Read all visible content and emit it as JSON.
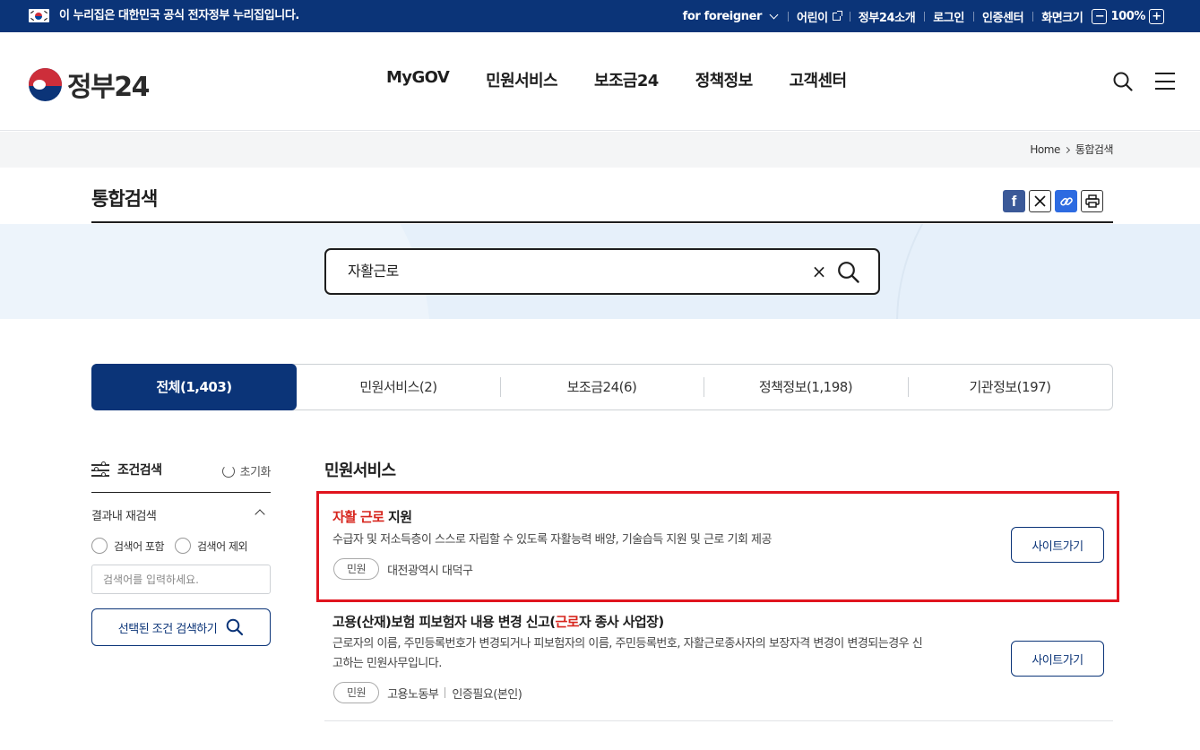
{
  "gov_banner": {
    "text": "이 누리집은 대한민국 공식 전자정부 누리집입니다.",
    "foreigner": "for foreigner",
    "kids": "어린이",
    "about": "정부24소개",
    "login": "로그인",
    "cert": "인증센터",
    "screen_size": "화면크기",
    "zoom_minus": "−",
    "zoom_value": "100%",
    "zoom_plus": "+"
  },
  "header": {
    "logo": "정부24",
    "menu": [
      "MyGOV",
      "민원서비스",
      "보조금24",
      "정책정보",
      "고객센터"
    ]
  },
  "breadcrumb": {
    "home": "Home",
    "current": "통합검색"
  },
  "page_title": "통합검색",
  "search": {
    "query": "자활근로",
    "clear": "×"
  },
  "tabs": [
    {
      "label": "전체(1,403)",
      "active": true
    },
    {
      "label": "민원서비스(2)"
    },
    {
      "label": "보조금24(6)"
    },
    {
      "label": "정책정보(1,198)"
    },
    {
      "label": "기관정보(197)"
    }
  ],
  "filter": {
    "title": "조건검색",
    "reset": "초기화",
    "section": "결과내 재검색",
    "include": "검색어 포함",
    "exclude": "검색어 제외",
    "placeholder": "검색어를 입력하세요.",
    "submit": "선택된 조건 검색하기"
  },
  "results": {
    "section_title": "민원서비스",
    "items": [
      {
        "title_hl": "자활 근로",
        "title_rest": " 지원",
        "desc": "수급자 및 저소득층이 스스로 자립할 수 있도록 자활능력 배양, 기술습득 지원 및 근로 기회 제공",
        "badge": "민원",
        "org": "대전광역시 대덕구",
        "button": "사이트가기"
      },
      {
        "title_pre": "고용(산재)보험 피보험자 내용 변경 신고(",
        "title_hl": "근로",
        "title_post": "자 종사 사업장)",
        "desc_1": "근로자의 이름, 주민등록번호가 변경되거나 피보험자의 이름, 주민등록번호, 자활근로종사자의 보장자격 변경이 변경되는경우 신",
        "desc_2": "고하는 민원사무입니다.",
        "badge": "민원",
        "org": "고용노동부",
        "auth": "인증필요(본인)",
        "button": "사이트가기"
      }
    ]
  }
}
